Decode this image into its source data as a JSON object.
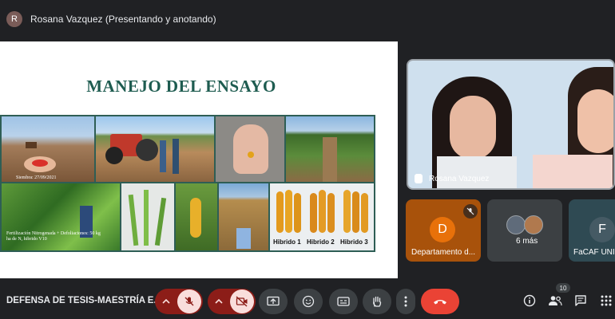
{
  "header": {
    "avatar_letter": "R",
    "presenter_label": "Rosana Vazquez (Presentando y anotando)"
  },
  "slide": {
    "title": "MANEJO DEL ENSAYO",
    "captions": {
      "sowing": "Siembra: 27/09/2021",
      "fertilizer": "Fertilización Nitrogenada + Defoliaciones: 50 kg ha de N, hibrido V10"
    },
    "hybrid_labels": [
      "Hibrido 1",
      "Hibrido 2",
      "Hibrido 3"
    ]
  },
  "participants": {
    "main": {
      "name": "Rosana Vazquez"
    },
    "tiles": [
      {
        "letter": "D",
        "name": "Departamento d...",
        "color": "#e8710a",
        "tile_color": "#a8520b"
      },
      {
        "name": "6 más"
      },
      {
        "letter": "F",
        "name": "FaCAF UNI",
        "color": "#455a64",
        "tile_color": "#2f4a53"
      }
    ]
  },
  "bottombar": {
    "meeting_title": "DEFENSA DE TESIS-MAESTRÍA E...",
    "participant_count": "10"
  },
  "colors": {
    "background": "#202124",
    "end_call": "#ea4335",
    "muted_bg": "#8c1d18",
    "muted_fg": "#f9dedc",
    "slide_title": "#1e5c50"
  }
}
